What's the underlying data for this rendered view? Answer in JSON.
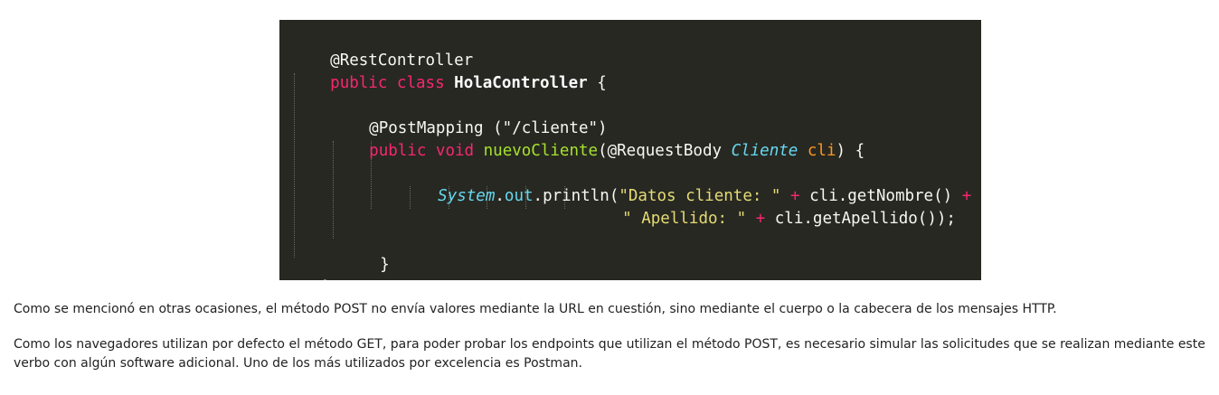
{
  "code_snippet": {
    "line1": {
      "annotation": "@RestController"
    },
    "line2": {
      "kw_public": "public",
      "kw_class": "class",
      "class_name": "HolaController",
      "brace": "{"
    },
    "line4": {
      "annotation": "@PostMapping",
      "args": " (\"/cliente\")"
    },
    "line5": {
      "kw_public": "public",
      "kw_void": "void",
      "method": "nuevoCliente",
      "open": "(@RequestBody ",
      "type": "Cliente",
      "param": "cli",
      "close": ") {"
    },
    "line7": {
      "type": "System",
      "dot1": ".",
      "field": "out",
      "call": ".println(",
      "str": "\"Datos cliente: \"",
      "plus": "+",
      "expr": "cli.getNombre()",
      "plus2": "+"
    },
    "line8": {
      "str": "\" Apellido: \"",
      "plus": "+",
      "expr": "cli.getApellido());"
    },
    "line10": {
      "brace": "}"
    },
    "line11": {
      "brace": "}"
    }
  },
  "paragraphs": [
    "Como se mencionó en otras ocasiones, el método POST no envía valores mediante la URL en cuestión, sino mediante el cuerpo o la cabecera de los mensajes HTTP.",
    "Como los navegadores utilizan por defecto el método GET, para poder probar los endpoints que utilizan el método POST, es necesario simular las solicitudes que se realizan mediante este verbo con algún software adicional. Uno de los más utilizados por excelencia es Postman."
  ],
  "colors": {
    "code_background": "#272822",
    "keyword": "#f92672",
    "function": "#a6e22e",
    "string": "#e6db74",
    "type": "#66d9ef",
    "parameter": "#fd971f",
    "body_text": "#222222"
  }
}
